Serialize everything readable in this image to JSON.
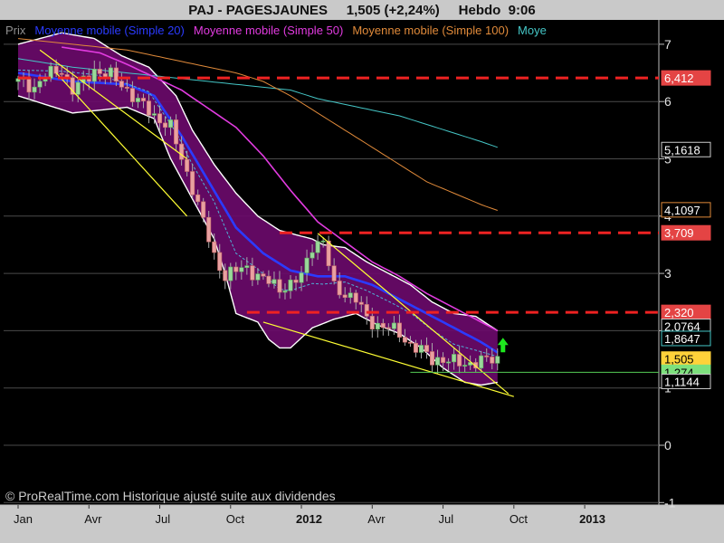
{
  "header": {
    "symbol": "PAJ - PAGESJAUNES",
    "quote": "1,505 (+2,24%)",
    "period": "Hebdo",
    "time": "9:06"
  },
  "legend": [
    {
      "label": "Prix",
      "color": "#8f8f8f"
    },
    {
      "label": "Moyenne mobile (Simple 20)",
      "color": "#2b3bff"
    },
    {
      "label": "Moyenne mobile (Simple 50)",
      "color": "#e23be0"
    },
    {
      "label": "Moyenne mobile (Simple 100)",
      "color": "#e08a3a"
    },
    {
      "label": "Moye",
      "color": "#45c6c6"
    }
  ],
  "copyright": "© ProRealTime.com Historique ajusté suite aux dividendes",
  "chart_data": {
    "type": "candlestick",
    "y_ticks": [
      7,
      6,
      5,
      4,
      3,
      2,
      1,
      0,
      -1
    ],
    "ylim": [
      -1.9,
      7.6
    ],
    "x_ticks": [
      {
        "label": "Jan",
        "week": 0
      },
      {
        "label": "Avr",
        "week": 13
      },
      {
        "label": "Jul",
        "week": 26
      },
      {
        "label": "Oct",
        "week": 39
      },
      {
        "label": "2012",
        "week": 52
      },
      {
        "label": "Avr",
        "week": 65
      },
      {
        "label": "Jul",
        "week": 78
      },
      {
        "label": "Oct",
        "week": 91
      },
      {
        "label": "2013",
        "week": 104
      }
    ],
    "close_anchors": [
      [
        0,
        6.35
      ],
      [
        3,
        6.25
      ],
      [
        5,
        6.45
      ],
      [
        8,
        6.55
      ],
      [
        10,
        6.2
      ],
      [
        12,
        6.35
      ],
      [
        14,
        6.55
      ],
      [
        17,
        6.45
      ],
      [
        19,
        6.3
      ],
      [
        22,
        6.0
      ],
      [
        25,
        5.75
      ],
      [
        28,
        5.55
      ],
      [
        30,
        5.0
      ],
      [
        32,
        4.5
      ],
      [
        34,
        3.9
      ],
      [
        36,
        3.3
      ],
      [
        38,
        2.95
      ],
      [
        40,
        3.05
      ],
      [
        42,
        3.1
      ],
      [
        44,
        2.95
      ],
      [
        46,
        2.85
      ],
      [
        48,
        2.75
      ],
      [
        50,
        2.8
      ],
      [
        52,
        2.95
      ],
      [
        54,
        3.5
      ],
      [
        56,
        3.55
      ],
      [
        58,
        2.75
      ],
      [
        60,
        2.65
      ],
      [
        62,
        2.55
      ],
      [
        64,
        2.2
      ],
      [
        66,
        2.1
      ],
      [
        68,
        2.05
      ],
      [
        70,
        1.95
      ],
      [
        72,
        1.75
      ],
      [
        74,
        1.65
      ],
      [
        76,
        1.5
      ],
      [
        78,
        1.5
      ],
      [
        80,
        1.45
      ],
      [
        82,
        1.42
      ],
      [
        84,
        1.45
      ],
      [
        87,
        1.5
      ],
      [
        88,
        1.505
      ]
    ],
    "ma20_anchors": [
      [
        0,
        6.5
      ],
      [
        10,
        6.35
      ],
      [
        20,
        6.3
      ],
      [
        25,
        6.1
      ],
      [
        30,
        5.4
      ],
      [
        35,
        4.6
      ],
      [
        40,
        3.8
      ],
      [
        45,
        3.35
      ],
      [
        50,
        3.05
      ],
      [
        55,
        2.95
      ],
      [
        60,
        2.95
      ],
      [
        65,
        2.8
      ],
      [
        70,
        2.55
      ],
      [
        75,
        2.3
      ],
      [
        80,
        2.05
      ],
      [
        85,
        1.8
      ],
      [
        88,
        1.62
      ]
    ],
    "ma50_anchors": [
      [
        8,
        6.95
      ],
      [
        15,
        6.85
      ],
      [
        20,
        6.65
      ],
      [
        30,
        6.2
      ],
      [
        40,
        5.55
      ],
      [
        45,
        5.05
      ],
      [
        50,
        4.45
      ],
      [
        55,
        3.9
      ],
      [
        60,
        3.55
      ],
      [
        65,
        3.2
      ],
      [
        70,
        2.95
      ],
      [
        75,
        2.65
      ],
      [
        80,
        2.4
      ],
      [
        85,
        2.15
      ],
      [
        88,
        2.0
      ]
    ],
    "ma100_anchors": [
      [
        0,
        7.1
      ],
      [
        10,
        7.0
      ],
      [
        20,
        6.9
      ],
      [
        30,
        6.7
      ],
      [
        40,
        6.5
      ],
      [
        45,
        6.35
      ],
      [
        50,
        6.1
      ],
      [
        55,
        5.8
      ],
      [
        60,
        5.5
      ],
      [
        65,
        5.2
      ],
      [
        70,
        4.9
      ],
      [
        75,
        4.6
      ],
      [
        80,
        4.4
      ],
      [
        85,
        4.2
      ],
      [
        88,
        4.1
      ]
    ],
    "ma200_anchors": [
      [
        0,
        6.75
      ],
      [
        10,
        6.6
      ],
      [
        20,
        6.5
      ],
      [
        30,
        6.4
      ],
      [
        40,
        6.3
      ],
      [
        50,
        6.2
      ],
      [
        55,
        6.05
      ],
      [
        60,
        5.95
      ],
      [
        65,
        5.85
      ],
      [
        70,
        5.75
      ],
      [
        75,
        5.6
      ],
      [
        80,
        5.45
      ],
      [
        85,
        5.3
      ],
      [
        88,
        5.2
      ]
    ],
    "bollinger_upper": [
      [
        0,
        7.0
      ],
      [
        8,
        7.2
      ],
      [
        14,
        7.1
      ],
      [
        19,
        6.8
      ],
      [
        24,
        6.6
      ],
      [
        29,
        6.1
      ],
      [
        32,
        5.5
      ],
      [
        36,
        4.9
      ],
      [
        40,
        4.4
      ],
      [
        44,
        4.0
      ],
      [
        48,
        3.75
      ],
      [
        50,
        3.7
      ],
      [
        54,
        3.6
      ],
      [
        56,
        3.5
      ],
      [
        60,
        3.45
      ],
      [
        64,
        3.2
      ],
      [
        68,
        3.0
      ],
      [
        72,
        2.8
      ],
      [
        76,
        2.5
      ],
      [
        80,
        2.3
      ],
      [
        84,
        2.25
      ],
      [
        88,
        2.0
      ]
    ],
    "bollinger_lower": [
      [
        0,
        6.1
      ],
      [
        5,
        5.95
      ],
      [
        10,
        5.8
      ],
      [
        15,
        5.85
      ],
      [
        20,
        5.9
      ],
      [
        25,
        5.7
      ],
      [
        28,
        5.0
      ],
      [
        32,
        4.3
      ],
      [
        36,
        3.6
      ],
      [
        38,
        3.0
      ],
      [
        40,
        2.3
      ],
      [
        44,
        2.15
      ],
      [
        46,
        1.85
      ],
      [
        48,
        1.7
      ],
      [
        50,
        1.7
      ],
      [
        54,
        2.05
      ],
      [
        58,
        2.2
      ],
      [
        62,
        2.3
      ],
      [
        66,
        2.1
      ],
      [
        70,
        1.95
      ],
      [
        74,
        1.7
      ],
      [
        78,
        1.35
      ],
      [
        82,
        1.1
      ],
      [
        85,
        1.05
      ],
      [
        88,
        1.1
      ]
    ],
    "support_resistance": [
      {
        "y": 6.412,
        "x_from": 0
      },
      {
        "y": 3.709,
        "x_from": 48
      },
      {
        "y": 2.32,
        "x_from": 42
      }
    ],
    "trendlines": [
      [
        [
          4,
          6.9
        ],
        [
          31,
          5.0
        ]
      ],
      [
        [
          7,
          6.5
        ],
        [
          31,
          4.0
        ]
      ],
      [
        [
          55,
          3.7
        ],
        [
          90,
          0.9
        ]
      ],
      [
        [
          45,
          2.15
        ],
        [
          91,
          0.85
        ]
      ]
    ],
    "horizontal_1274": {
      "y": 1.274,
      "x_from": 72
    },
    "price_labels": [
      {
        "text": "6,412",
        "y": 6.412,
        "box": "#e44444",
        "color": "#fff",
        "fill": true
      },
      {
        "text": "5,1618",
        "y": 5.1618,
        "box": "#cccccc",
        "color": "#fff",
        "fill": false
      },
      {
        "text": "4,1097",
        "y": 4.1097,
        "box": "#e08a3a",
        "color": "#fff",
        "fill": false
      },
      {
        "text": "3,709",
        "y": 3.709,
        "box": "#e44444",
        "color": "#fff",
        "fill": true
      },
      {
        "text": "2,320",
        "y": 2.32,
        "box": "#e44444",
        "color": "#fff",
        "fill": true
      },
      {
        "text": "2,0764",
        "y": 2.0764,
        "box": "#cccccc",
        "color": "#fff",
        "fill": false
      },
      {
        "text": "1,8647",
        "y": 1.8647,
        "box": "#45c6c6",
        "color": "#fff",
        "fill": false
      },
      {
        "text": "1,505",
        "y": 1.505,
        "box": "#ffd23a",
        "color": "#000",
        "fill": true
      },
      {
        "text": "1,274",
        "y": 1.274,
        "box": "#7de07d",
        "color": "#000",
        "fill": true
      },
      {
        "text": "1,1144",
        "y": 1.1144,
        "box": "#cccccc",
        "color": "#fff",
        "fill": false
      }
    ],
    "signal_arrow": {
      "week": 89,
      "y": 1.75,
      "color": "#1ee81e"
    }
  }
}
